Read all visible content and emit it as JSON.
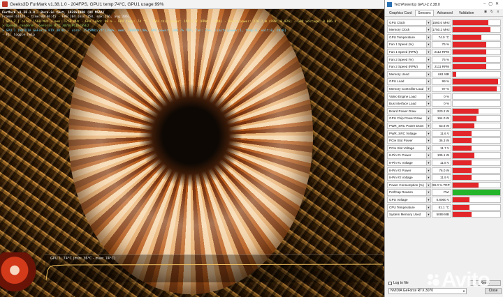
{
  "furmark": {
    "window_title": "Geeks3D FurMark v1.38.1.0 - 204FPS, GPU1 temp:74°C, GPU1 usage:99%",
    "osd": {
      "line1": "FurMark v1.38.1.0 - Burn-in test, 1920x1080 (0X MSAA)",
      "line2": "Frames:61424 - time:00:06:45 - FPS:204 (min:158, max:216, avg:206)",
      "line3": "[ GPU-Z ] core: 1560 MHz - mem: 1750 MHz - GPU load: 99 % - GPU temp: 74 °C - GPU chip power: 164.0 W (PPW: 1.244) - Board power: 220.2 W (PPW: 0.926) - GPU voltage: 0.806 V",
      "line4": "> OpenGL renderer: GeForce RTX 3070/PCIe/SSE2",
      "line5": "> GPU 1 (NVIDIA GeForce RTX 3070) - core: 1545MHz/74°C/99%, mem: 7000MHz/8%, GPU power: 100.7% TDP, fan: 76%, limits[power:1, temp:0, volt:0, OV:0]",
      "line6": "- F1: toggle help"
    },
    "graph_label": "GPU 1: 74°C (min: 36°C - max: 74°C)"
  },
  "gpuz": {
    "window_title": "TechPowerUp GPU-Z 2.38.0",
    "tabs": [
      "Graphics Card",
      "Sensors",
      "Advanced",
      "Validation"
    ],
    "active_tab": "Sensors",
    "sensors": [
      {
        "name": "GPU Clock",
        "value": "1560.0 MHz",
        "fill": 0.75
      },
      {
        "name": "Memory Clock",
        "value": "1750.2 MHz",
        "fill": 0.8
      },
      {
        "name": "GPU Temperature",
        "value": "74.0 °C",
        "fill": 0.6
      },
      {
        "name": "Fan 1 Speed (%)",
        "value": "76 %",
        "fill": 0.7
      },
      {
        "name": "Fan 1 Speed (RPM)",
        "value": "2112 RPM",
        "fill": 0.7
      },
      {
        "name": "Fan 2 Speed (%)",
        "value": "76 %",
        "fill": 0.7
      },
      {
        "name": "Fan 2 Speed (RPM)",
        "value": "2111 RPM",
        "fill": 0.7
      },
      {
        "name": "Memory Used",
        "value": "661 MB",
        "fill": 0.08
      },
      {
        "name": "GPU Load",
        "value": "99 %",
        "fill": 0.95
      },
      {
        "name": "Memory Controller Load",
        "value": "97 %",
        "fill": 0.92
      },
      {
        "name": "Video Engine Load",
        "value": "0 %",
        "fill": 0
      },
      {
        "name": "Bus Interface Load",
        "value": "0 %",
        "fill": 0
      },
      {
        "name": "Board Power Draw",
        "value": "220.2 W",
        "fill": 0.55
      },
      {
        "name": "GPU Chip Power Draw",
        "value": "164.0 W",
        "fill": 0.5
      },
      {
        "name": "PWR_SRC Power Draw",
        "value": "53.8 W",
        "fill": 0.45
      },
      {
        "name": "PWR_SRC Voltage",
        "value": "11.6 V",
        "fill": 0.4
      },
      {
        "name": "PCIe Slot Power",
        "value": "36.3 W",
        "fill": 0.4
      },
      {
        "name": "PCIe Slot Voltage",
        "value": "11.7 V",
        "fill": 0.4
      },
      {
        "name": "8-Pin #1 Power",
        "value": "105.1 W",
        "fill": 0.45
      },
      {
        "name": "8-Pin #1 Voltage",
        "value": "11.8 V",
        "fill": 0.4
      },
      {
        "name": "8-Pin #2 Power",
        "value": "76.0 W",
        "fill": 0.4
      },
      {
        "name": "8-Pin #2 Voltage",
        "value": "11.9 V",
        "fill": 0.4
      },
      {
        "name": "Power Consumption (%)",
        "value": "99.0 % TDP",
        "fill": 0.55
      },
      {
        "name": "PerfCap Reason",
        "value": "Pwr",
        "fill": 1,
        "color": "green"
      },
      {
        "name": "GPU Voltage",
        "value": "0.8060 V",
        "fill": 0.35
      },
      {
        "name": "CPU Temperature",
        "value": "51.1 °C",
        "fill": 0.35
      },
      {
        "name": "System Memory Used",
        "value": "5089 MB",
        "fill": 0.4
      }
    ],
    "log_to_file": "Log to file",
    "reset_label": "Reset",
    "gpu_select": "NVIDIA GeForce RTX 3070",
    "close_label": "Close"
  },
  "watermark": "Avito",
  "colors": {
    "graph_fill": "#e2262a",
    "perfcap": "#25b52b"
  }
}
